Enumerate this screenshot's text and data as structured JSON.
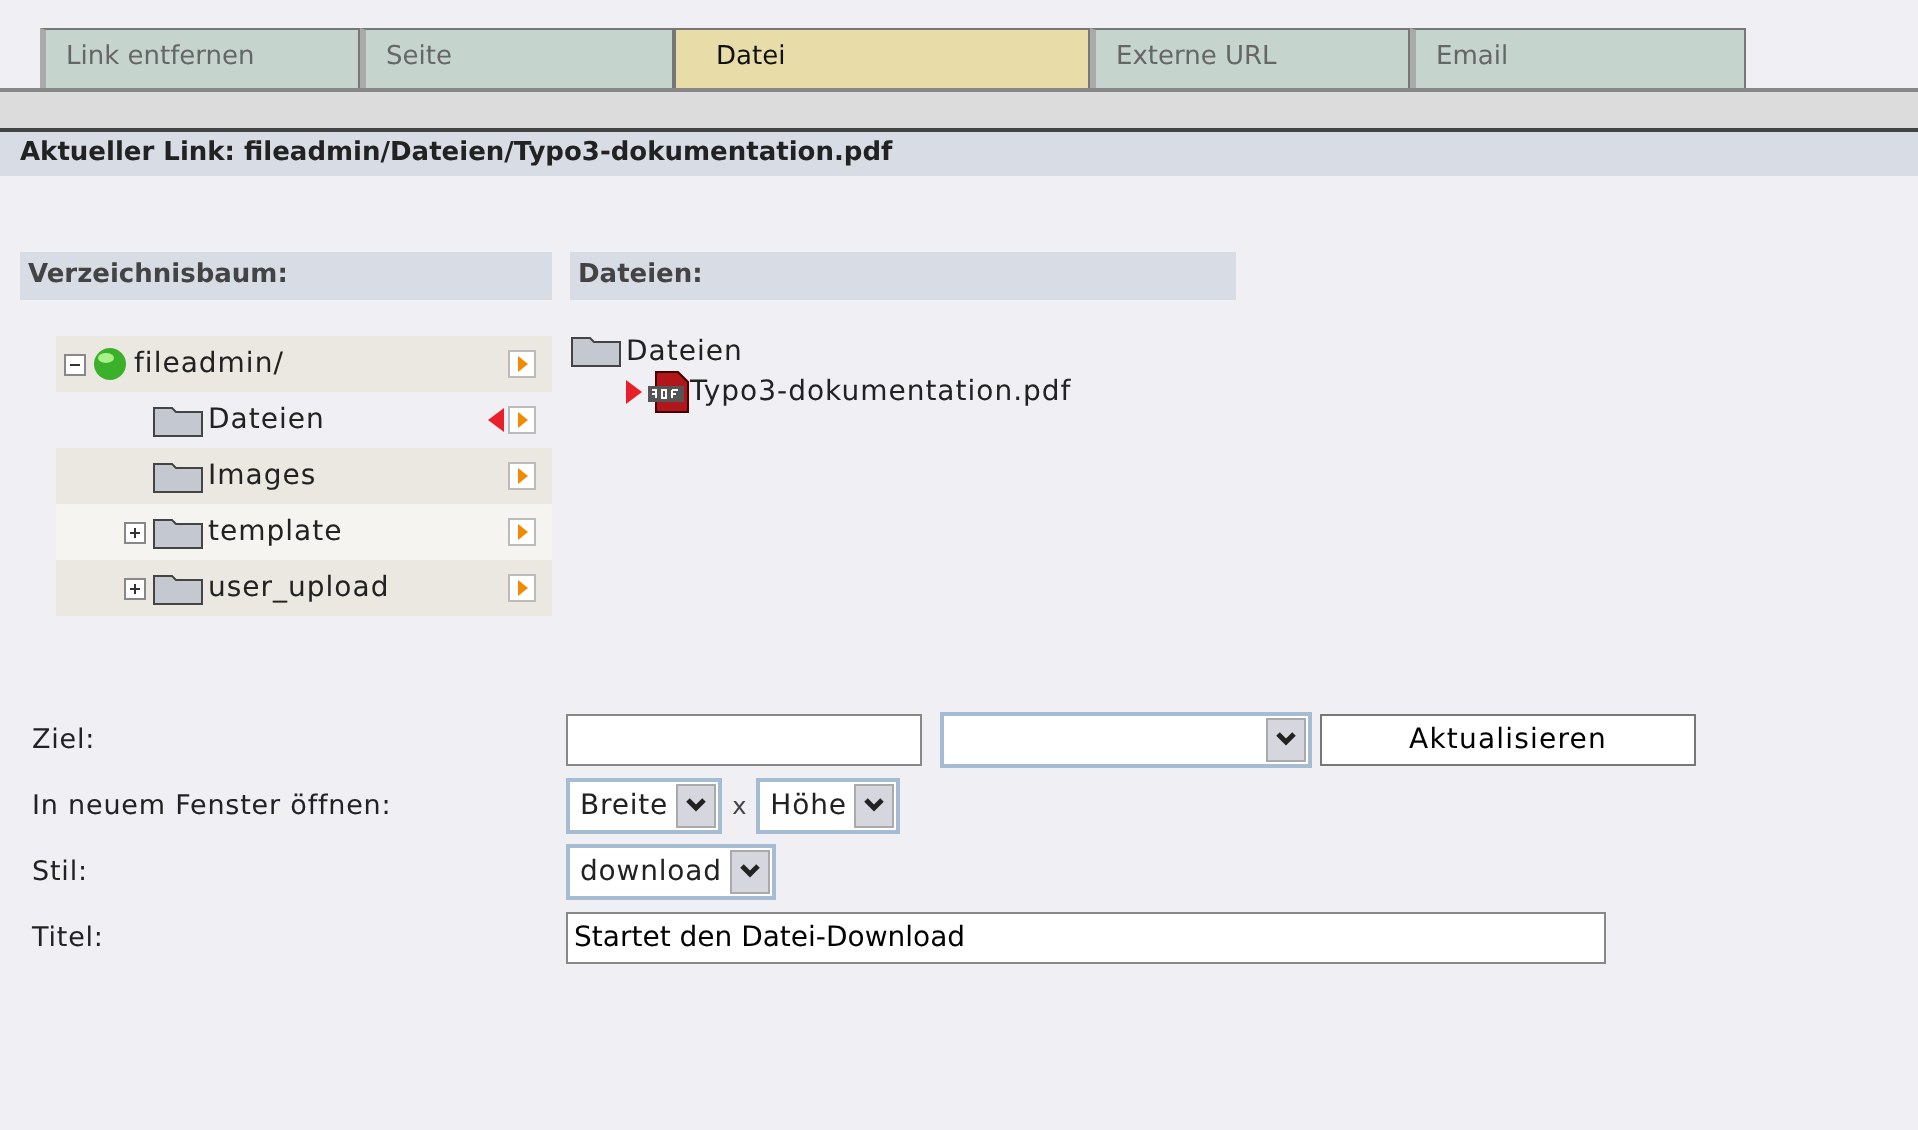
{
  "tabs": [
    {
      "label": "Link entfernen",
      "selected": false
    },
    {
      "label": "Seite",
      "selected": false
    },
    {
      "label": "Datei",
      "selected": true
    },
    {
      "label": "Externe URL",
      "selected": false
    },
    {
      "label": "Email",
      "selected": false
    }
  ],
  "current_link": {
    "label": "Aktueller Link:",
    "value": "fileadmin/Dateien/Typo3-dokumentation.pdf"
  },
  "tree": {
    "title": "Verzeichnisbaum:",
    "items": [
      {
        "label": "fileadmin/",
        "kind": "globe",
        "expanded": true,
        "selected": false,
        "children": [
          {
            "label": "Dateien",
            "kind": "folder",
            "selected": true
          },
          {
            "label": "Images",
            "kind": "folder",
            "selected": false
          },
          {
            "label": "template",
            "kind": "folder",
            "expanded": false,
            "selected": false
          },
          {
            "label": "user_upload",
            "kind": "folder",
            "expanded": false,
            "selected": false
          }
        ]
      }
    ]
  },
  "files": {
    "title": "Dateien:",
    "folder": "Dateien",
    "items": [
      {
        "label": "Typo3-dokumentation.pdf",
        "selected": true
      }
    ]
  },
  "form": [
    {
      "label": "Ziel:",
      "controls": [
        {
          "kind": "input"
        },
        {
          "kind": "select"
        },
        {
          "kind": "button",
          "value": "Aktualisieren"
        }
      ]
    },
    {
      "label": "In neuem Fenster öffnen:",
      "controls": [
        {
          "kind": "select",
          "value": "Breite"
        },
        {
          "kind": "text",
          "value": "x"
        },
        {
          "kind": "select",
          "value": "Höhe"
        }
      ]
    },
    {
      "label": "Stil:",
      "controls": [
        {
          "kind": "select",
          "value": "download"
        }
      ]
    },
    {
      "label": "Titel:",
      "controls": [
        {
          "kind": "wide-input",
          "value": "Startet den Datei-Download"
        }
      ]
    }
  ]
}
